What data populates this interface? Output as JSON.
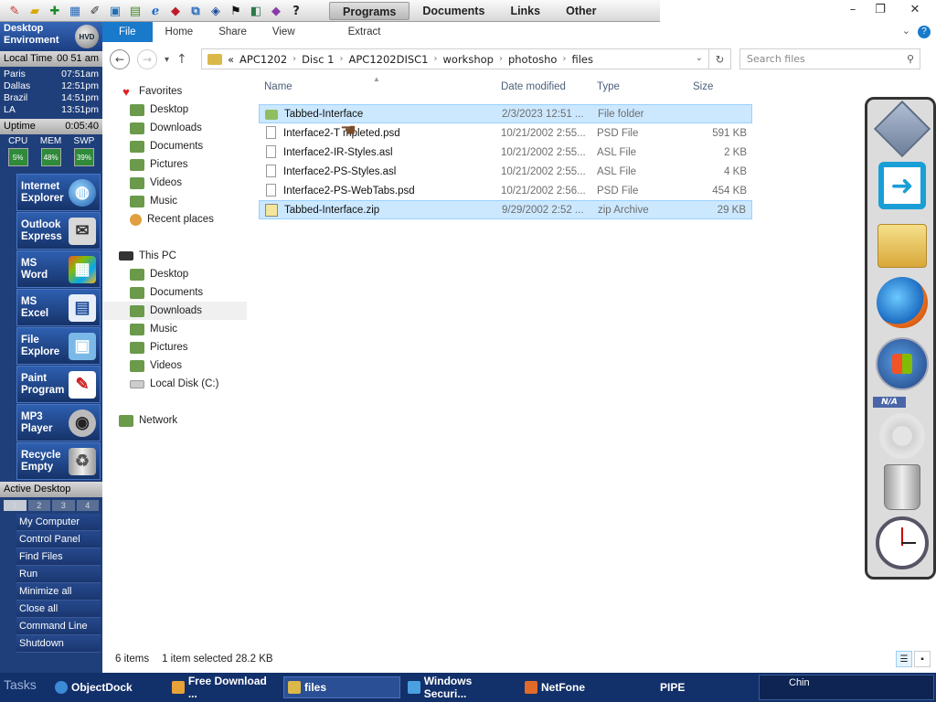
{
  "topbar": {
    "quicklaunch_icons": [
      "paint-icon",
      "notepad-icon",
      "add-icon",
      "calculator-icon",
      "paint-palette-icon",
      "image-icon",
      "scanner-icon",
      "ie-icon",
      "media-icon",
      "network-icon",
      "shield-icon",
      "run-icon",
      "contacts-icon",
      "book-icon",
      "help-icon"
    ],
    "tabs": [
      {
        "label": "Programs",
        "active": true
      },
      {
        "label": "Documents",
        "active": false
      },
      {
        "label": "Links",
        "active": false
      },
      {
        "label": "Other",
        "active": false
      }
    ]
  },
  "window_controls": {
    "minimize": "–",
    "restore": "❐",
    "close": "✕"
  },
  "sidepanel": {
    "title": "Desktop Enviroment",
    "logo_text": "HVD",
    "local_time_label": "Local Time",
    "local_time_value": "00 51 am",
    "clocks": [
      {
        "city": "Paris",
        "time": "07:51am"
      },
      {
        "city": "Dallas",
        "time": "12:51pm"
      },
      {
        "city": "Brazil",
        "time": "14:51pm"
      },
      {
        "city": "LA",
        "time": "13:51pm"
      }
    ],
    "uptime_label": "Uptime",
    "uptime_value": "0:05:40",
    "meters": [
      {
        "label": "CPU",
        "value": "5%"
      },
      {
        "label": "MEM",
        "value": "48%"
      },
      {
        "label": "SWP",
        "value": "39%"
      }
    ],
    "launchers": [
      {
        "label1": "Internet",
        "label2": "Explorer",
        "icon": "globe-icon"
      },
      {
        "label1": "Outlook",
        "label2": "Express",
        "icon": "mail-icon"
      },
      {
        "label1": "MS",
        "label2": "Word",
        "icon": "word-icon"
      },
      {
        "label1": "MS",
        "label2": "Excel",
        "icon": "excel-icon"
      },
      {
        "label1": "File",
        "label2": "Explore",
        "icon": "explorer-icon"
      },
      {
        "label1": "Paint",
        "label2": "Program",
        "icon": "paint-icon"
      },
      {
        "label1": "MP3",
        "label2": "Player",
        "icon": "speaker-icon"
      },
      {
        "label1": "Recycle",
        "label2": "Empty",
        "icon": "recycle-icon"
      }
    ],
    "active_desktop_label": "Active Desktop",
    "desktops": [
      "1",
      "2",
      "3",
      "4"
    ],
    "commands": [
      "My Computer",
      "Control Panel",
      "Find Files",
      "Run",
      "Minimize all",
      "Close all",
      "Command Line",
      "Shutdown"
    ]
  },
  "ribbon": {
    "tabs": [
      "File",
      "Home",
      "Share",
      "View"
    ],
    "context_tab": "Extract"
  },
  "address": {
    "breadcrumb": [
      "APC1202",
      "Disc 1",
      "APC1202DISC1",
      "workshop",
      "photosho",
      "files"
    ],
    "prefix": "«",
    "search_placeholder": "Search files"
  },
  "navpane": {
    "favorites_label": "Favorites",
    "favorites": [
      "Desktop",
      "Downloads",
      "Documents",
      "Pictures",
      "Videos",
      "Music",
      "Recent places"
    ],
    "thispc_label": "This PC",
    "thispc": [
      "Desktop",
      "Documents",
      "Downloads",
      "Music",
      "Pictures",
      "Videos",
      "Local Disk (C:)"
    ],
    "network_label": "Network",
    "selected": "Downloads"
  },
  "filelist": {
    "columns": {
      "name": "Name",
      "date": "Date modified",
      "type": "Type",
      "size": "Size"
    },
    "rows": [
      {
        "name": "Tabbed-Interface",
        "date": "2/3/2023 12:51 ...",
        "type": "File folder",
        "size": "",
        "kind": "folder",
        "selected": true
      },
      {
        "name": "Interface2-T  mpleted.psd",
        "date": "10/21/2002 2:55...",
        "type": "PSD File",
        "size": "591 KB",
        "kind": "doc",
        "selected": false
      },
      {
        "name": "Interface2-IR-Styles.asl",
        "date": "10/21/2002 2:55...",
        "type": "ASL File",
        "size": "2 KB",
        "kind": "doc",
        "selected": false
      },
      {
        "name": "Interface2-PS-Styles.asl",
        "date": "10/21/2002 2:55...",
        "type": "ASL File",
        "size": "4 KB",
        "kind": "doc",
        "selected": false
      },
      {
        "name": "Interface2-PS-WebTabs.psd",
        "date": "10/21/2002 2:56...",
        "type": "PSD File",
        "size": "454 KB",
        "kind": "doc",
        "selected": false
      },
      {
        "name": "Tabbed-Interface.zip",
        "date": "9/29/2002 2:52 ...",
        "type": "zip Archive",
        "size": "29 KB",
        "kind": "zip",
        "selected": true
      }
    ]
  },
  "status": {
    "items": "6 items",
    "selected": "1 item selected  28.2 KB"
  },
  "dock": {
    "na_label": "N/A"
  },
  "taskbar": {
    "label": "Tasks",
    "buttons": [
      {
        "label": "ObjectDock",
        "color": "#3a8ad6"
      },
      {
        "label": "Free Download ...",
        "color": "#e8a23a"
      },
      {
        "label": "files",
        "color": "#dbb84a",
        "active": true
      },
      {
        "label": "Windows Securi...",
        "color": "#4aa0e0"
      },
      {
        "label": "NetFone",
        "color": "#e06a2a"
      },
      {
        "label": "PIPE",
        "color": ""
      }
    ],
    "tray_text": "Chin"
  }
}
